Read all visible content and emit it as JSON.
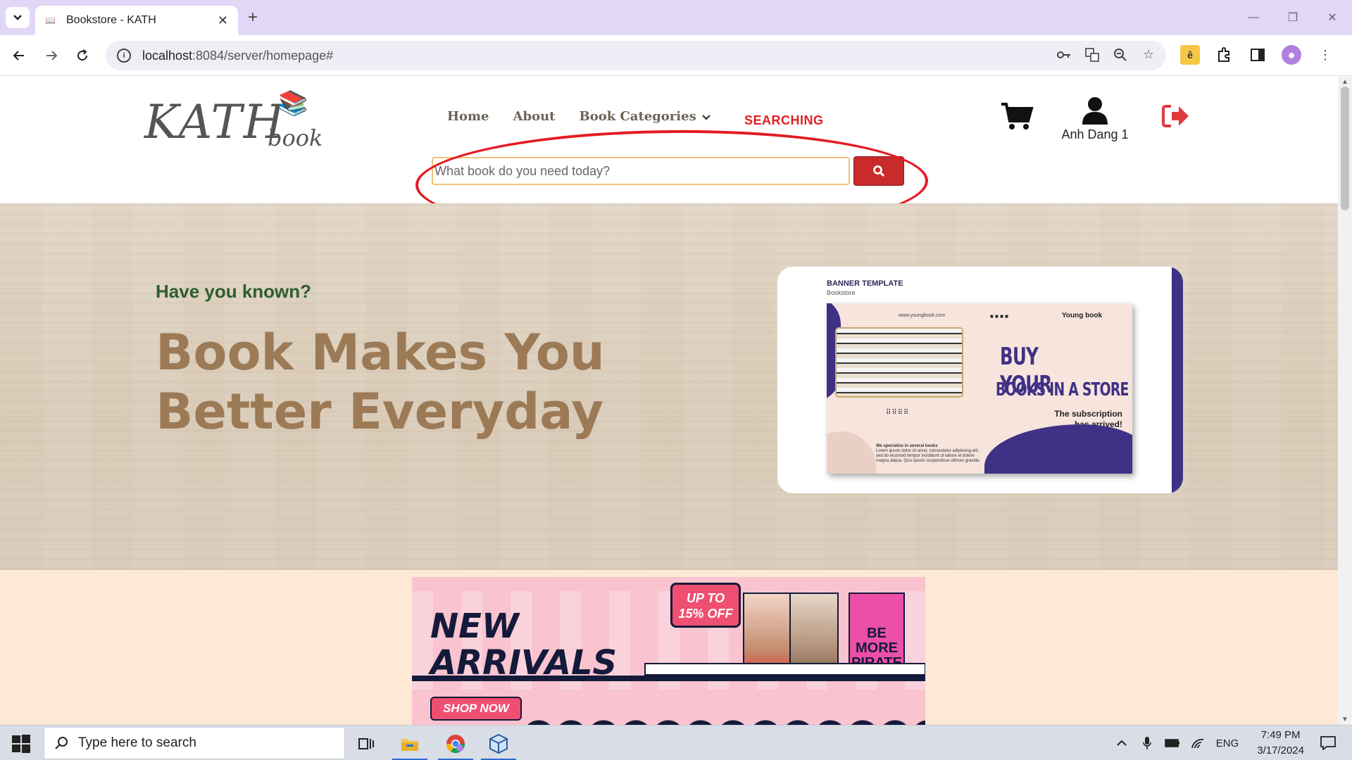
{
  "browser": {
    "tab_title": "Bookstore - KATH",
    "url_host": "localhost",
    "url_rest": ":8084/server/homepage#",
    "new_tab_symbol": "+",
    "close_tab_symbol": "✕"
  },
  "site": {
    "logo_main": "KATH",
    "logo_sub": "book",
    "nav": {
      "home": "Home",
      "about": "About",
      "categories": "Book Categories"
    },
    "annotation_label": "SEARCHING",
    "search": {
      "placeholder": "What book do you need today?"
    },
    "user_name": "Anh Dang 1"
  },
  "hero": {
    "subtitle": "Have you known?",
    "title": "Book Makes You Better Everyday",
    "banner": {
      "label": "BANNER TEMPLATE",
      "sublabel": "Bookstore",
      "url": "www.youngbook.com",
      "brand": "Young book",
      "headline1": "BUY YOUR",
      "headline2": "BOOKS IN A STORE",
      "subhead": "The subscription has arrived!",
      "small_heading": "We specialize in several books",
      "small_text": "Lorem ipsum dolor sit amet, consectetur adipiscing elit, sed do eiusmod tempor incididunt ut labore et dolore magna aliqua. Quis ipsum suspendisse ultrices gravida."
    }
  },
  "arrivals": {
    "title_line1": "NEW",
    "title_line2": "ARRIVALS",
    "promo_line1": "UP TO",
    "promo_line2": "15% OFF",
    "book3_title": "BE MORE PIRATE",
    "shop_now": "SHOP NOW"
  },
  "taskbar": {
    "search_placeholder": "Type here to search",
    "language": "ENG",
    "time": "7:49 PM",
    "date": "3/17/2024"
  },
  "colors": {
    "accent_red": "#c92a2a",
    "hero_title": "#9c7a56",
    "hero_sub": "#2e5e2e",
    "browser_tabbar": "#e3d7f7"
  }
}
